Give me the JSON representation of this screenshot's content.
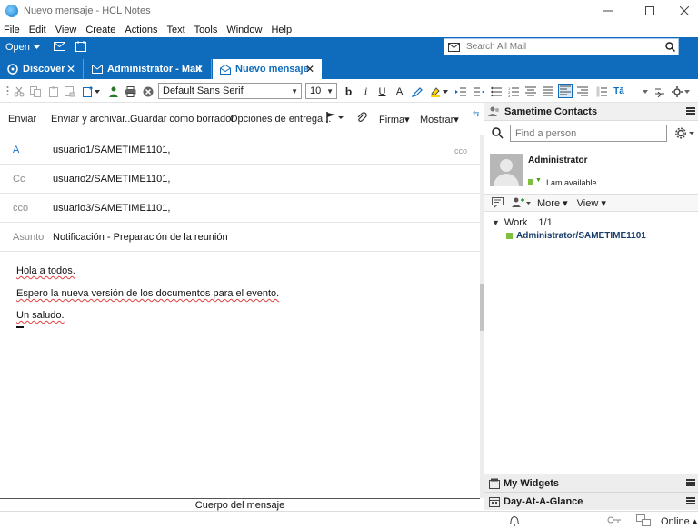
{
  "window": {
    "title": "Nuevo mensaje - HCL Notes"
  },
  "menu": [
    "File",
    "Edit",
    "View",
    "Create",
    "Actions",
    "Text",
    "Tools",
    "Window",
    "Help"
  ],
  "bluebar": {
    "open_label": "Open",
    "search_placeholder": "Search All Mail"
  },
  "tabs": [
    {
      "label": "Discover"
    },
    {
      "label": "Administrator - Mail"
    },
    {
      "label": "Nuevo mensaje"
    }
  ],
  "format": {
    "font": "Default Sans Serif",
    "size": "10"
  },
  "actions": {
    "send": "Enviar",
    "send_file": "Enviar y archivar...",
    "save_draft": "Guardar como borrador",
    "delivery": "Opciones de entrega...",
    "signature": "Firma",
    "show": "Mostrar"
  },
  "fields": {
    "to_label": "A",
    "to_value": "usuario1/SAMETIME1101,",
    "cco_link": "cco",
    "cc_label": "Cc",
    "cc_value": "usuario2/SAMETIME1101,",
    "bcc_label": "cco",
    "bcc_value": "usuario3/SAMETIME1101,",
    "subject_label": "Asunto",
    "subject_value": "Notificación - Preparación de la reunión"
  },
  "body": {
    "line1": "Hola a todos.",
    "line2": "Espero la nueva versión de los documentos para el evento.",
    "line3": "Un saludo."
  },
  "body_section_label": "Cuerpo del mensaje",
  "sametime": {
    "title": "Sametime Contacts",
    "find_placeholder": "Find a person",
    "user_name": "Administrator",
    "status": "I am available",
    "more_label": "More",
    "view_label": "View",
    "group_name": "Work",
    "group_count": "1/1",
    "contact": "Administrator/SAMETIME1101"
  },
  "panels": {
    "widgets": "My Widgets",
    "day": "Day-At-A-Glance"
  },
  "statusbar": {
    "online": "Online"
  },
  "colors": {
    "accent": "#0f6cbd",
    "available": "#7dc13f"
  }
}
